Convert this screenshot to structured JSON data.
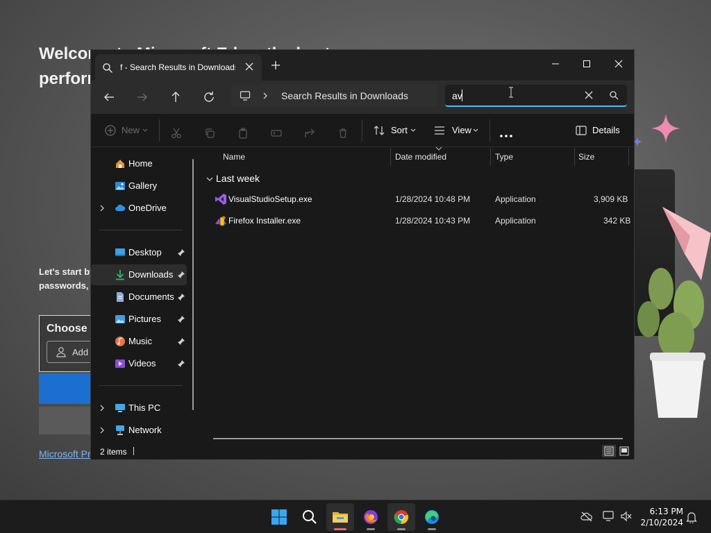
{
  "background": {
    "headline": "Welcome to Microsoft Edge, the best performing browser on Windows",
    "subtext": "Let's start by importing your favorites, passwords, and more",
    "choose_title": "Choose a profile",
    "add_button": "Add",
    "link": "Microsoft Privacy Statement"
  },
  "window": {
    "tab_title": "f - Search Results in Downloads",
    "address": "Search Results in Downloads",
    "search": {
      "value": "av",
      "placeholder": ""
    }
  },
  "toolbar": {
    "new_label": "New",
    "sort_label": "Sort",
    "view_label": "View",
    "details_label": "Details"
  },
  "sidebar": {
    "items": [
      {
        "label": "Home",
        "icon": "home-icon"
      },
      {
        "label": "Gallery",
        "icon": "gallery-icon"
      },
      {
        "label": "OneDrive",
        "icon": "onedrive-icon"
      },
      {
        "label": "Desktop",
        "icon": "desktop-icon"
      },
      {
        "label": "Downloads",
        "icon": "downloads-icon"
      },
      {
        "label": "Documents",
        "icon": "documents-icon"
      },
      {
        "label": "Pictures",
        "icon": "pictures-icon"
      },
      {
        "label": "Music",
        "icon": "music-icon"
      },
      {
        "label": "Videos",
        "icon": "videos-icon"
      },
      {
        "label": "This PC",
        "icon": "this-pc-icon"
      },
      {
        "label": "Network",
        "icon": "network-icon"
      }
    ],
    "selected": "Downloads"
  },
  "columns": {
    "name": "Name",
    "date": "Date modified",
    "type": "Type",
    "size": "Size"
  },
  "group": {
    "label": "Last week"
  },
  "files": [
    {
      "name": "VisualStudioSetup.exe",
      "date": "1/28/2024 10:48 PM",
      "type": "Application",
      "size": "3,909 KB"
    },
    {
      "name": "Firefox Installer.exe",
      "date": "1/28/2024 10:43 PM",
      "type": "Application",
      "size": "342 KB"
    }
  ],
  "status": {
    "count": "2 items"
  },
  "clock": {
    "time": "6:13 PM",
    "date": "2/10/2024"
  },
  "colors": {
    "accent": "#4cc2ff",
    "window_bg": "#191919",
    "chrome_bg": "#202020",
    "taskbar_bg": "#1c1c1c"
  }
}
